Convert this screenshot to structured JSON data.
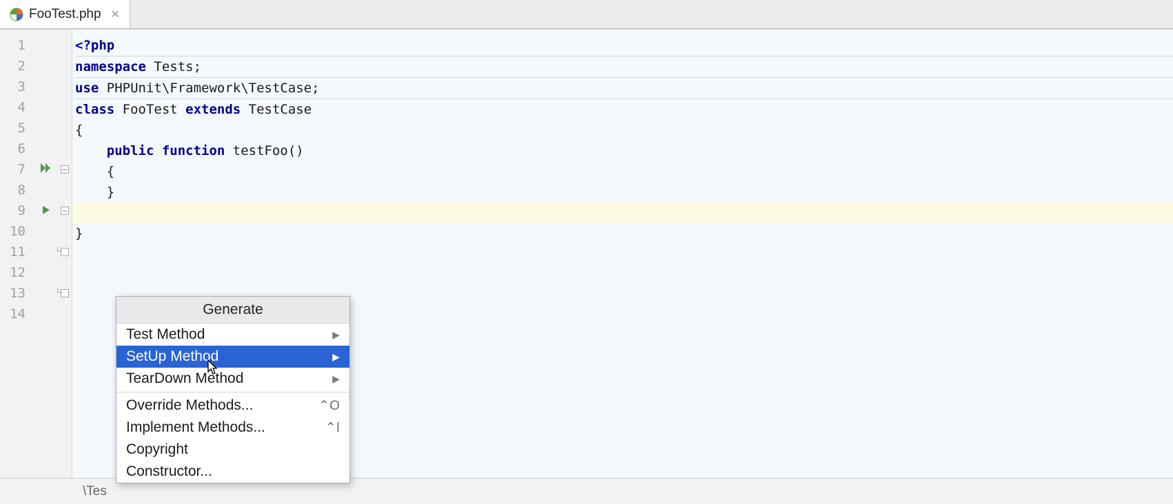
{
  "tab": {
    "filename": "FooTest.php"
  },
  "gutter": [
    "1",
    "2",
    "3",
    "4",
    "5",
    "6",
    "7",
    "8",
    "9",
    "10",
    "11",
    "12",
    "13",
    "14"
  ],
  "code": {
    "l1": {
      "p1": "<?php"
    },
    "l3": {
      "p1": "namespace ",
      "p2": "Tests;"
    },
    "l5": {
      "p1": "use ",
      "p2": "PHPUnit\\Framework\\TestCase;"
    },
    "l7": {
      "p1": "class ",
      "p2": "FooTest ",
      "p3": "extends ",
      "p4": "TestCase"
    },
    "l8": {
      "p1": "{"
    },
    "l9": {
      "p1": "    ",
      "p2": "public function ",
      "p3": "testFoo()"
    },
    "l10": {
      "p1": "    {"
    },
    "l11": {
      "p1": "    }"
    },
    "l13": {
      "p1": "}"
    }
  },
  "breadcrumb": "\\Tes",
  "popup": {
    "title": "Generate",
    "items": [
      {
        "label": "Test Method",
        "submenu": true
      },
      {
        "label": "SetUp Method",
        "submenu": true,
        "selected": true
      },
      {
        "label": "TearDown Method",
        "submenu": true
      },
      {
        "sep": true
      },
      {
        "label": "Override Methods...",
        "shortcut": "⌃O"
      },
      {
        "label": "Implement Methods...",
        "shortcut": "⌃I"
      },
      {
        "label": "Copyright"
      },
      {
        "label": "Constructor..."
      }
    ]
  }
}
